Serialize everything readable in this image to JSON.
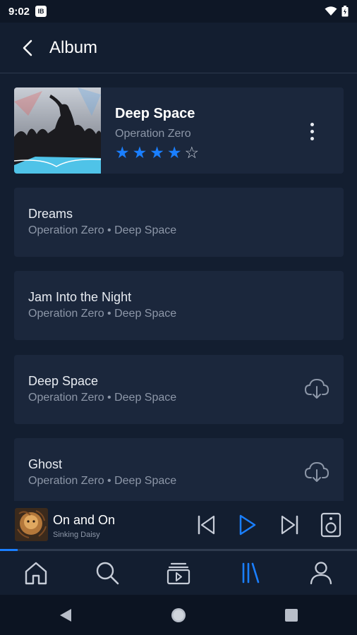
{
  "status_bar": {
    "time": "9:02",
    "badge": "IB"
  },
  "header": {
    "title": "Album"
  },
  "album": {
    "title": "Deep Space",
    "artist": "Operation Zero",
    "rating": 4,
    "rating_max": 5
  },
  "tracks": [
    {
      "title": "Dreams",
      "subtitle": "Operation Zero • Deep Space",
      "download": false
    },
    {
      "title": "Jam Into the Night",
      "subtitle": "Operation Zero • Deep Space",
      "download": false
    },
    {
      "title": "Deep Space",
      "subtitle": "Operation Zero • Deep Space",
      "download": true
    },
    {
      "title": "Ghost",
      "subtitle": "Operation Zero • Deep Space",
      "download": true
    }
  ],
  "now_playing": {
    "title": "On and On",
    "artist": "Sinking Daisy",
    "progress": 0.05
  },
  "bottom_nav": {
    "items": [
      "home-icon",
      "search-icon",
      "videos-icon",
      "library-icon",
      "profile-icon"
    ],
    "active": "library-icon"
  },
  "colors": {
    "background": "#131e30",
    "card": "#1b273c",
    "accent": "#1a7fff",
    "muted_text": "#8d97a8"
  }
}
